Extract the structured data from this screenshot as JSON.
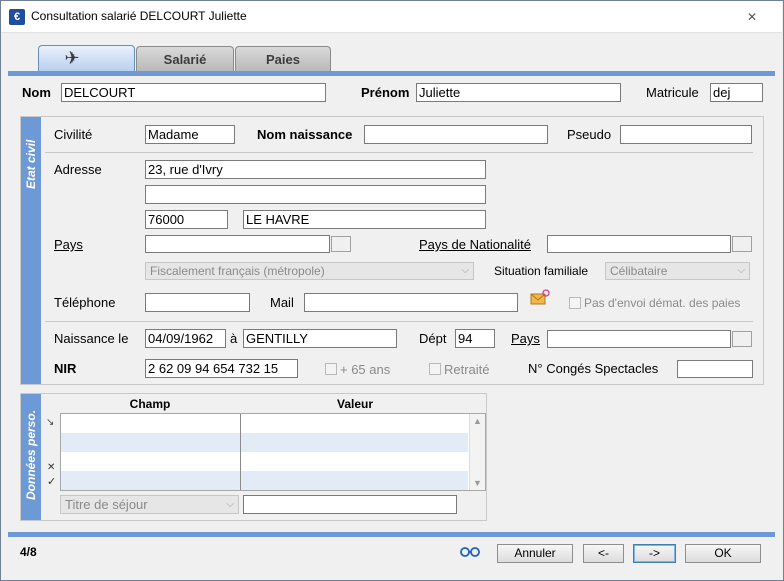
{
  "window": {
    "title": "Consultation salarié DELCOURT Juliette",
    "close_glyph": "✕",
    "app_icon_glyph": "€"
  },
  "tabs": [
    {
      "label": "",
      "icon": "people-handshake-icon",
      "icon_glyph": "✈"
    },
    {
      "label": "Salarié"
    },
    {
      "label": "Paies"
    }
  ],
  "header": {
    "nom_label": "Nom",
    "nom_value": "DELCOURT",
    "prenom_label": "Prénom",
    "prenom_value": "Juliette",
    "matricule_label": "Matricule",
    "matricule_value": "dej"
  },
  "etat_civil": {
    "section_label": "Etat civil",
    "civilite_label": "Civilité",
    "civilite_value": "Madame",
    "nom_naissance_label": "Nom naissance",
    "nom_naissance_value": "",
    "pseudo_label": "Pseudo",
    "pseudo_value": "",
    "adresse_label": "Adresse",
    "adresse_line1": "23, rue d'Ivry",
    "adresse_line2": "",
    "code_postal": "76000",
    "ville": "LE HAVRE",
    "pays_label": "Pays",
    "pays_value": "",
    "pays_nationalite_label": "Pays de Nationalité",
    "pays_nationalite_value": "",
    "fiscalite_value": "Fiscalement français (métropole)",
    "situation_familiale_label": "Situation familiale",
    "situation_familiale_value": "Célibataire",
    "telephone_label": "Téléphone",
    "telephone_value": "",
    "mail_label": "Mail",
    "mail_value": "",
    "pas_envoi_label": "Pas d'envoi démat. des paies",
    "naissance_label": "Naissance le",
    "naissance_date": "04/09/1962",
    "a_label": "à",
    "naissance_lieu": "GENTILLY",
    "dept_label": "Dépt",
    "dept_value": "94",
    "naissance_pays_label": "Pays",
    "naissance_pays_value": "",
    "nir_label": "NIR",
    "nir_value": "2 62 09 94 654 732 15",
    "plus65_label": "+ 65 ans",
    "retraite_label": "Retraité",
    "conges_label": "N° Congés Spectacles",
    "conges_value": ""
  },
  "donnees_perso": {
    "section_label": "Données perso.",
    "columns": [
      "Champ",
      "Valeur"
    ],
    "rows": [
      {
        "champ": "",
        "valeur": ""
      },
      {
        "champ": "",
        "valeur": ""
      },
      {
        "champ": "",
        "valeur": ""
      },
      {
        "champ": "",
        "valeur": ""
      }
    ],
    "marker_glyphs": {
      "current": "↘",
      "delete": "✕",
      "validate": "✓"
    },
    "combo_value": "Titre de séjour",
    "combo_input_value": ""
  },
  "footer": {
    "record_position": "4/8",
    "glasses_glyph": "👓",
    "annuler_label": "Annuler",
    "prev_label": "<-",
    "next_label": "->",
    "ok_label": "OK"
  },
  "colors": {
    "accent": "#6d99d6",
    "window_border": "#6f7f95"
  }
}
